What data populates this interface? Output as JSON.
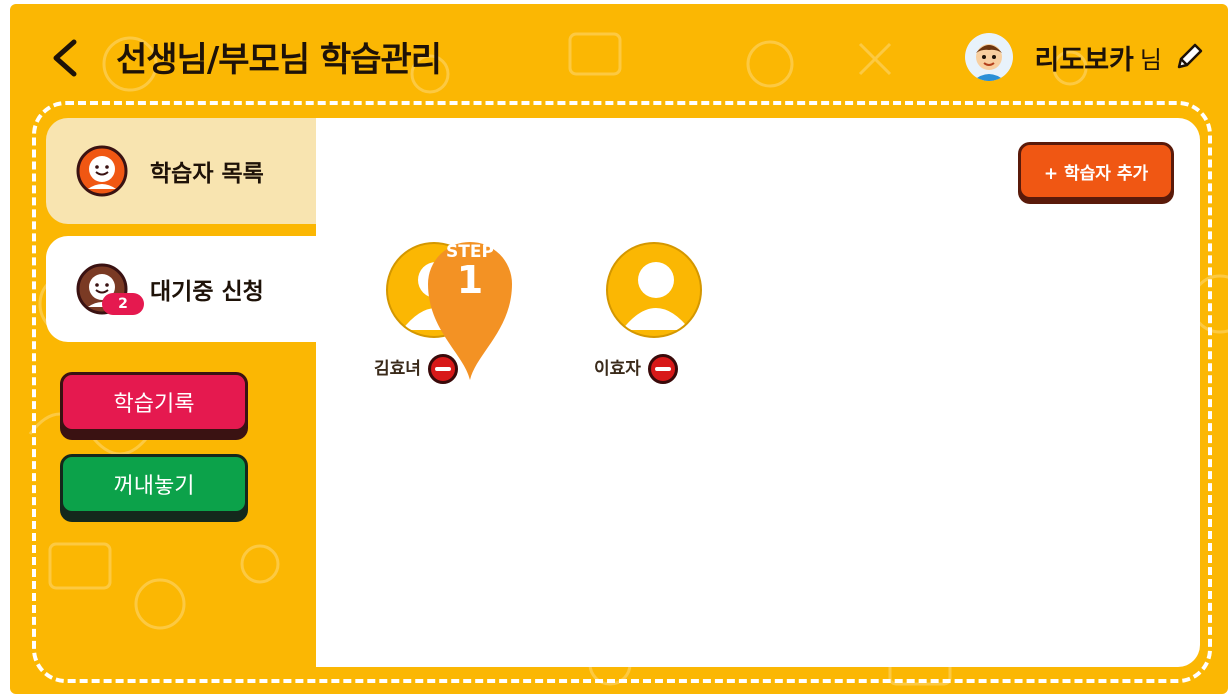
{
  "header": {
    "title": "선생님/부모님 학습관리",
    "user_name": "리도보카",
    "user_suffix": "님"
  },
  "sidebar": {
    "tabs": [
      {
        "label": "학습자 목록",
        "icon": "smiley-face-icon",
        "active": false
      },
      {
        "label": "대기중 신청",
        "icon": "smiley-face-icon",
        "badge": "2",
        "active": true
      }
    ],
    "buttons": [
      {
        "label": "학습기록",
        "color": "#e5194f"
      },
      {
        "label": "꺼내놓기",
        "color": "#0ca24a"
      }
    ]
  },
  "panel": {
    "add_button_label": "+ 학습자 추가",
    "learners": [
      {
        "name": "김효녀",
        "avatar": "person-placeholder-icon"
      },
      {
        "name": "이효자",
        "avatar": "person-placeholder-icon"
      }
    ],
    "step_marker": {
      "word": "STEP",
      "number": "1"
    }
  },
  "colors": {
    "background": "#fbb703",
    "accent_red": "#e5194f",
    "accent_green": "#0ca24a",
    "add_button": "#f05713",
    "step_marker": "#f39224"
  }
}
